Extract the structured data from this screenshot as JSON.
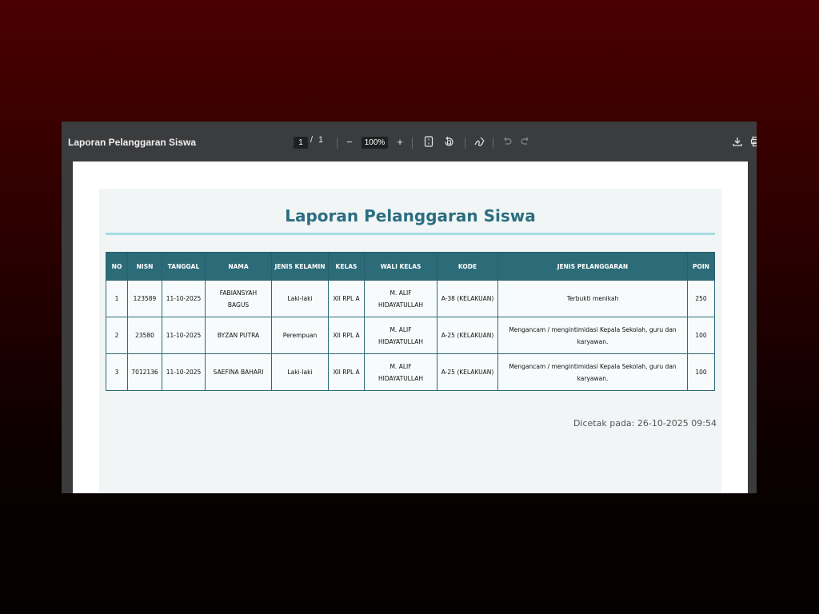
{
  "viewer": {
    "doc_title": "Laporan Pelanggaran Siswa",
    "page_current": "1",
    "page_sep": "/",
    "page_total": "1",
    "zoom": "100%",
    "icons": {
      "zoom_out": "minus-icon",
      "zoom_in": "plus-icon",
      "fit": "fit-page-icon",
      "rotate": "rotate-icon",
      "annotate": "draw-icon",
      "undo": "undo-icon",
      "redo": "redo-icon",
      "download": "download-icon",
      "print": "print-icon"
    }
  },
  "report": {
    "title": "Laporan Pelanggaran Siswa",
    "columns": [
      "NO",
      "NISN",
      "TANGGAL",
      "NAMA",
      "JENIS KELAMIN",
      "KELAS",
      "WALI KELAS",
      "KODE",
      "JENIS PELANGGARAN",
      "POIN"
    ],
    "rows": [
      [
        "1",
        "123589",
        "11-10-2025",
        "FABIANSYAH BAGUS",
        "Laki-laki",
        "XII RPL A",
        "M. ALIF HIDAYATULLAH",
        "A-38 (KELAKUAN)",
        "Terbukti menikah",
        "250"
      ],
      [
        "2",
        "23580",
        "11-10-2025",
        "BYZAN PUTRA",
        "Perempuan",
        "XII RPL A",
        "M. ALIF HIDAYATULLAH",
        "A-25 (KELAKUAN)",
        "Mengancam / mengintimidasi Kepala Sekolah, guru dan karyawan.",
        "100"
      ],
      [
        "3",
        "7012136",
        "11-10-2025",
        "SAEFINA BAHARI",
        "Laki-laki",
        "XII RPL A",
        "M. ALIF HIDAYATULLAH",
        "A-25 (KELAKUAN)",
        "Mengancam / mengintimidasi Kepala Sekolah, guru dan karyawan.",
        "100"
      ]
    ],
    "printed_at": "Dicetak pada: 26-10-2025 09:54"
  },
  "colors": {
    "header_bg": "#2c6b78",
    "title": "#2c6e80",
    "rule": "#a6dde1",
    "background_top": "#4a0000"
  }
}
